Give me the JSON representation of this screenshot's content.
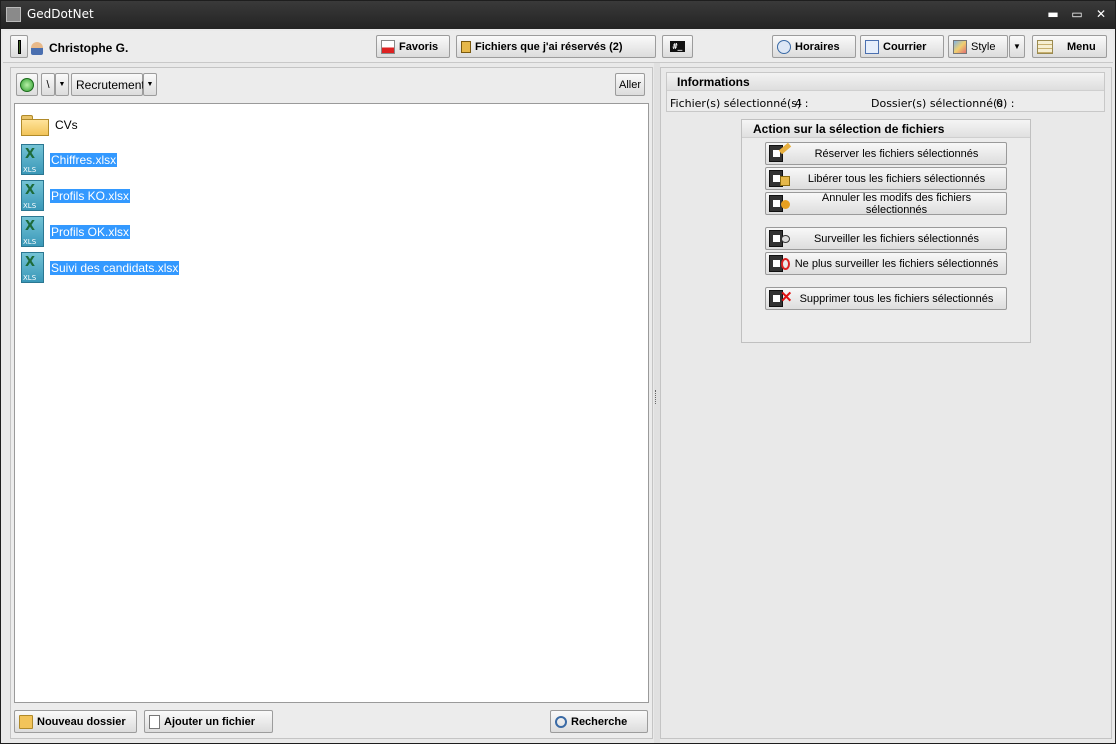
{
  "window": {
    "title": "GedDotNet",
    "minimize": "▬",
    "maximize": "▭",
    "close": "✕"
  },
  "toolbar": {
    "user": "Christophe G.",
    "favoris": "Favoris",
    "reserved": "Fichiers que j'ai réservés (2)",
    "console": "#_",
    "horaires": "Horaires",
    "courrier": "Courrier",
    "style": "Style",
    "menu": "Menu"
  },
  "nav": {
    "path_sep": "\\",
    "path_folder": "Recrutement",
    "go": "Aller"
  },
  "files": [
    {
      "name": "CVs",
      "type": "folder",
      "selected": false
    },
    {
      "name": "Chiffres.xlsx",
      "type": "xls",
      "selected": true
    },
    {
      "name": "Profils KO.xlsx",
      "type": "xls",
      "selected": true
    },
    {
      "name": "Profils OK.xlsx",
      "type": "xls",
      "selected": true
    },
    {
      "name": "Suivi des candidats.xlsx",
      "type": "xls",
      "selected": true
    }
  ],
  "xls_label": "XLS",
  "bottom": {
    "new_folder": "Nouveau dossier",
    "add_file": "Ajouter un fichier",
    "search": "Recherche"
  },
  "info": {
    "title": "Informations",
    "files_label": "Fichier(s) sélectionné(s) :",
    "files_count": "4",
    "folders_label": "Dossier(s) sélectionné(s) :",
    "folders_count": "0"
  },
  "actions": {
    "title": "Action sur la sélection de fichiers",
    "reserve": "Réserver les fichiers sélectionnés",
    "release": "Libérer tous les fichiers sélectionnés",
    "cancel": "Annuler les modifs des fichiers sélectionnés",
    "watch": "Surveiller les fichiers sélectionnés",
    "unwatch": "Ne plus surveiller les fichiers sélectionnés",
    "delete": "Supprimer tous les fichiers sélectionnés"
  },
  "colors": {
    "selection": "#3399ff",
    "titlebar": "#2b2b2b"
  }
}
